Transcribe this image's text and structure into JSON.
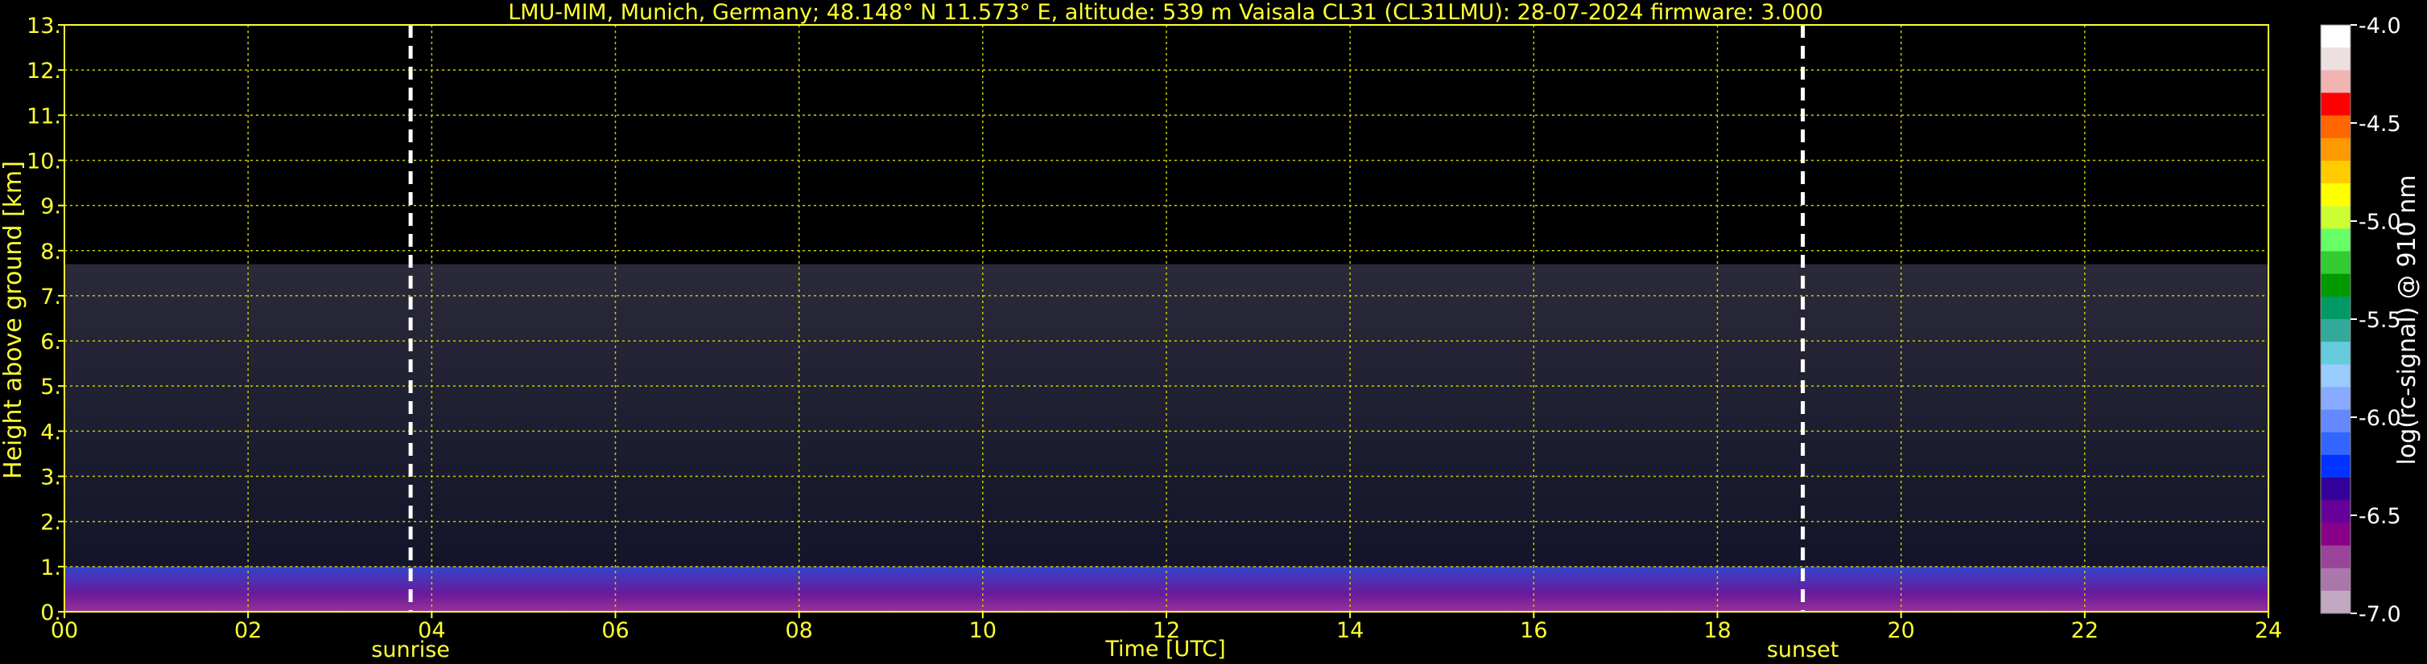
{
  "chart_data": {
    "type": "heatmap",
    "title": "LMU-MIM, Munich, Germany; 48.148° N 11.573° E, altitude: 539 m    Vaisala CL31 (CL31LMU): 28-07-2024    firmware: 3.000",
    "xlabel": "Time [UTC]",
    "ylabel": "Height above ground [km]",
    "xlim": [
      0,
      24
    ],
    "ylim": [
      0,
      13
    ],
    "x_ticks": [
      "00",
      "02",
      "04",
      "06",
      "08",
      "10",
      "12",
      "14",
      "16",
      "18",
      "20",
      "22",
      "24"
    ],
    "y_ticks": [
      "0.",
      "1.",
      "2.",
      "3.",
      "4.",
      "5.",
      "6.",
      "7.",
      "8.",
      "9.",
      "10.",
      "11.",
      "12.",
      "13."
    ],
    "grid": true,
    "markers": [
      {
        "label": "sunrise",
        "x": 3.77
      },
      {
        "label": "sunset",
        "x": 18.93
      }
    ],
    "colorbar": {
      "label": "log(rc-signal) @ 910 nm",
      "range": [
        -7.0,
        -4.0
      ],
      "ticks": [
        "-4.0",
        "-4.5",
        "-5.0",
        "-5.5",
        "-6.0",
        "-6.5",
        "-7.0"
      ],
      "colors": [
        "#ffffff",
        "#ede0e0",
        "#f2b3b3",
        "#ff0000",
        "#ff6600",
        "#ff9900",
        "#ffcc00",
        "#ffff00",
        "#ccff33",
        "#66ff66",
        "#33cc33",
        "#009900",
        "#009966",
        "#33aa99",
        "#66ccdd",
        "#99ccff",
        "#88aaff",
        "#6688ff",
        "#3366ff",
        "#0033ff",
        "#330099",
        "#660099",
        "#880088",
        "#994499",
        "#aa77aa",
        "#c0a8c0"
      ]
    },
    "signal_layers": [
      {
        "name": "noise",
        "y_range": [
          1.0,
          7.7
        ]
      },
      {
        "name": "boundary_layer",
        "y_range": [
          0.0,
          1.0
        ]
      }
    ]
  }
}
